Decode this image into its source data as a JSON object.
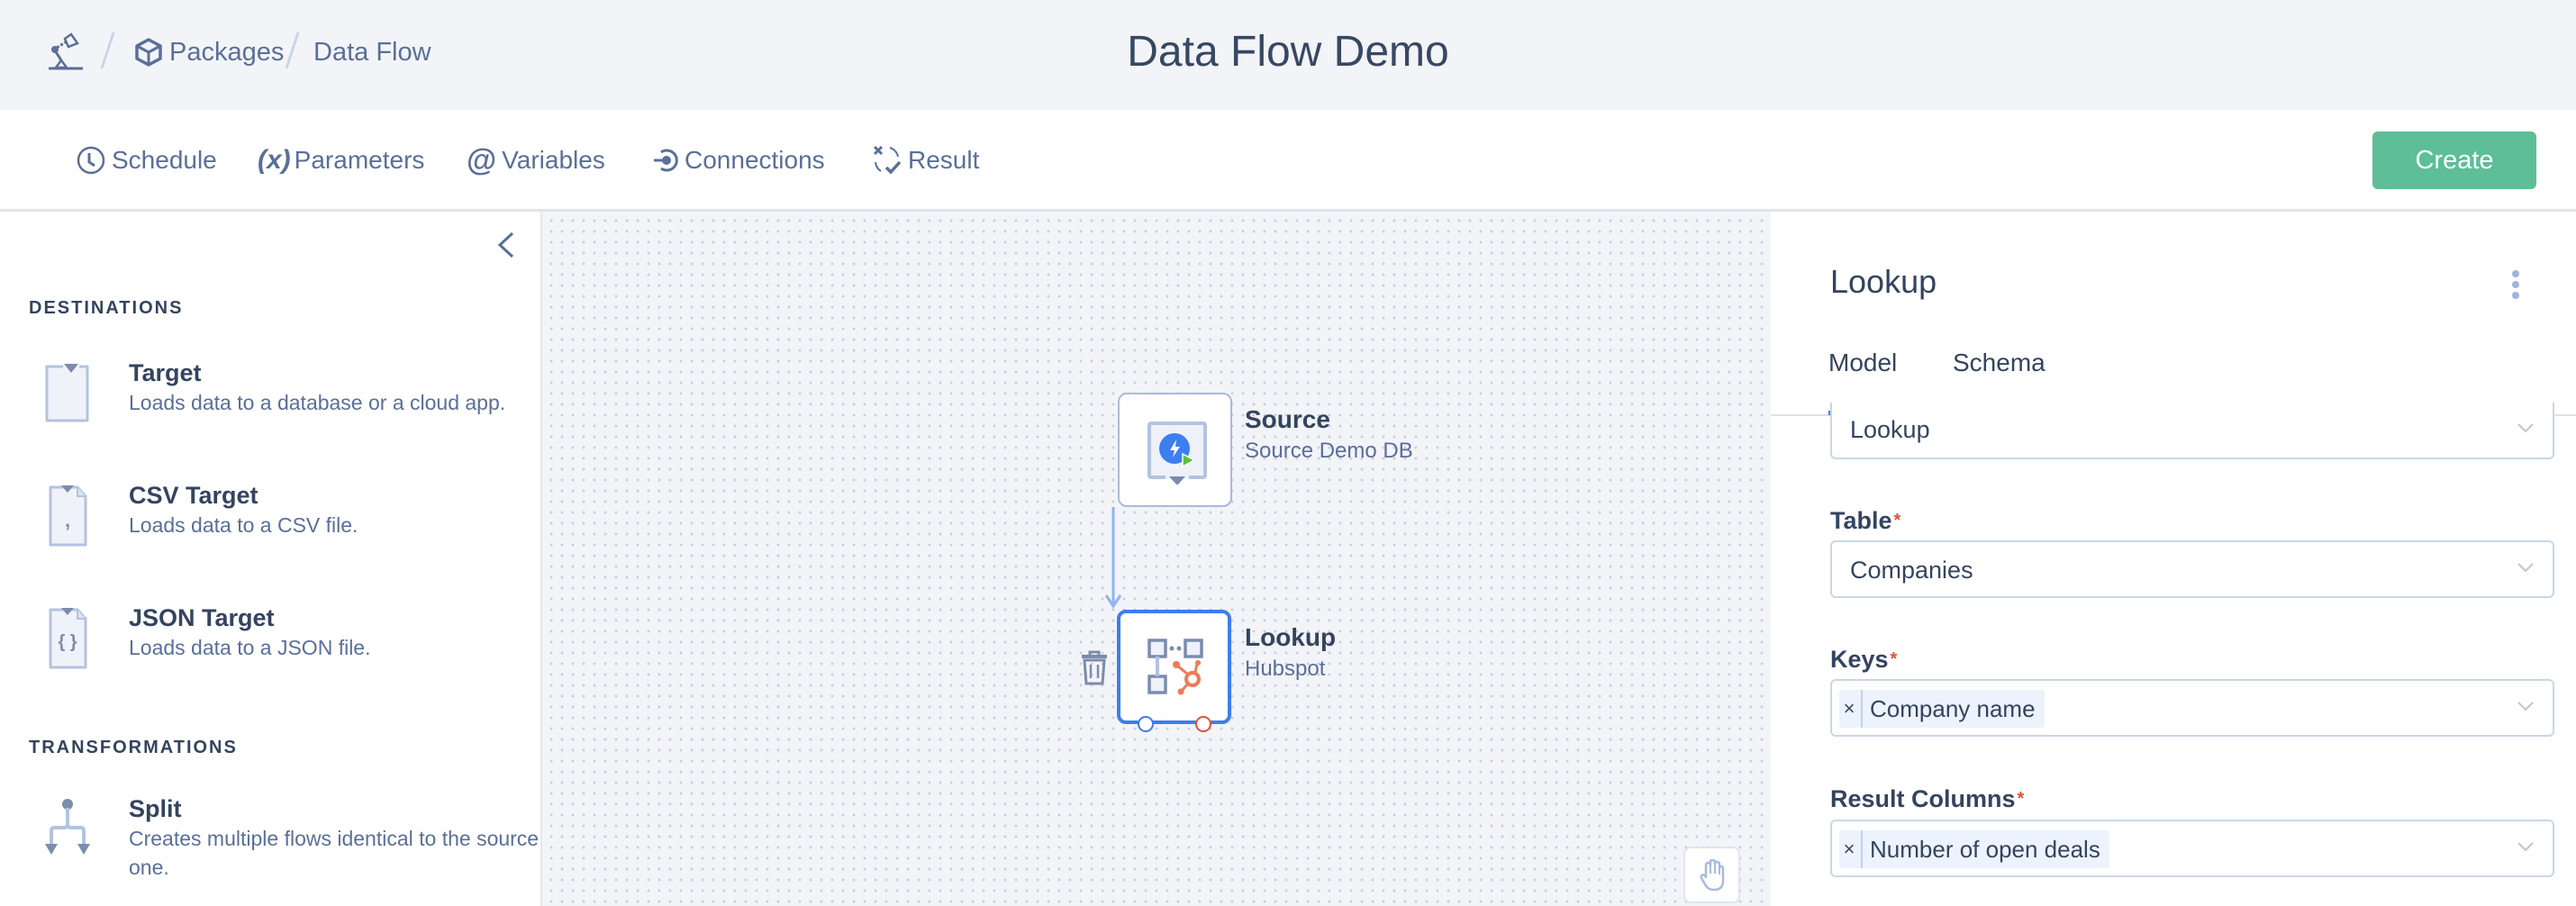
{
  "header": {
    "breadcrumb": [
      {
        "icon": "lamp-home-icon"
      },
      {
        "icon": "package-icon",
        "label": "Packages"
      },
      {
        "label": "Data Flow"
      }
    ],
    "title": "Data Flow Demo"
  },
  "toolbar": {
    "items": [
      {
        "icon": "clock-icon",
        "label": "Schedule"
      },
      {
        "icon": "function-x-icon",
        "label": "Parameters"
      },
      {
        "icon": "at-sign-icon",
        "label": "Variables"
      },
      {
        "icon": "connection-icon",
        "label": "Connections"
      },
      {
        "icon": "result-icon",
        "label": "Result"
      }
    ],
    "create_label": "Create",
    "accent": "#5dbe98"
  },
  "sidebar": {
    "collapse_icon": "chevron-left-icon",
    "sections": [
      {
        "title": "DESTINATIONS",
        "items": [
          {
            "icon": "target-icon",
            "title": "Target",
            "desc": "Loads data to a database or a cloud app."
          },
          {
            "icon": "csv-file-icon",
            "title": "CSV Target",
            "desc": "Loads data to a CSV file."
          },
          {
            "icon": "json-file-icon",
            "title": "JSON Target",
            "desc": "Loads data to a JSON file."
          }
        ]
      },
      {
        "title": "TRANSFORMATIONS",
        "items": [
          {
            "icon": "split-icon",
            "title": "Split",
            "desc": "Creates multiple flows identical to the source one."
          }
        ]
      }
    ]
  },
  "canvas": {
    "nodes": [
      {
        "id": "source",
        "title": "Source",
        "subtitle": "Source Demo DB",
        "icon": "source-db-icon"
      },
      {
        "id": "lookup",
        "title": "Lookup",
        "subtitle": "Hubspot",
        "icon": "lookup-hubspot-icon",
        "selected": true
      }
    ],
    "edges": [
      {
        "from": "source",
        "to": "lookup"
      }
    ],
    "hand_tool_icon": "hand-icon",
    "delete_icon": "trash-icon"
  },
  "panel": {
    "title": "Lookup",
    "tabs": [
      {
        "label": "Model",
        "active": true
      },
      {
        "label": "Schema",
        "active": false
      }
    ],
    "fields": [
      {
        "label": "",
        "value": "Lookup",
        "type": "select"
      },
      {
        "label": "Table",
        "required": true,
        "value": "Companies",
        "type": "select"
      },
      {
        "label": "Keys",
        "required": true,
        "type": "multiselect",
        "chips": [
          "Company name"
        ]
      },
      {
        "label": "Result Columns",
        "required": true,
        "type": "multiselect",
        "chips": [
          "Number of open deals"
        ]
      }
    ],
    "required_marker": "*",
    "chip_remove": "×"
  }
}
